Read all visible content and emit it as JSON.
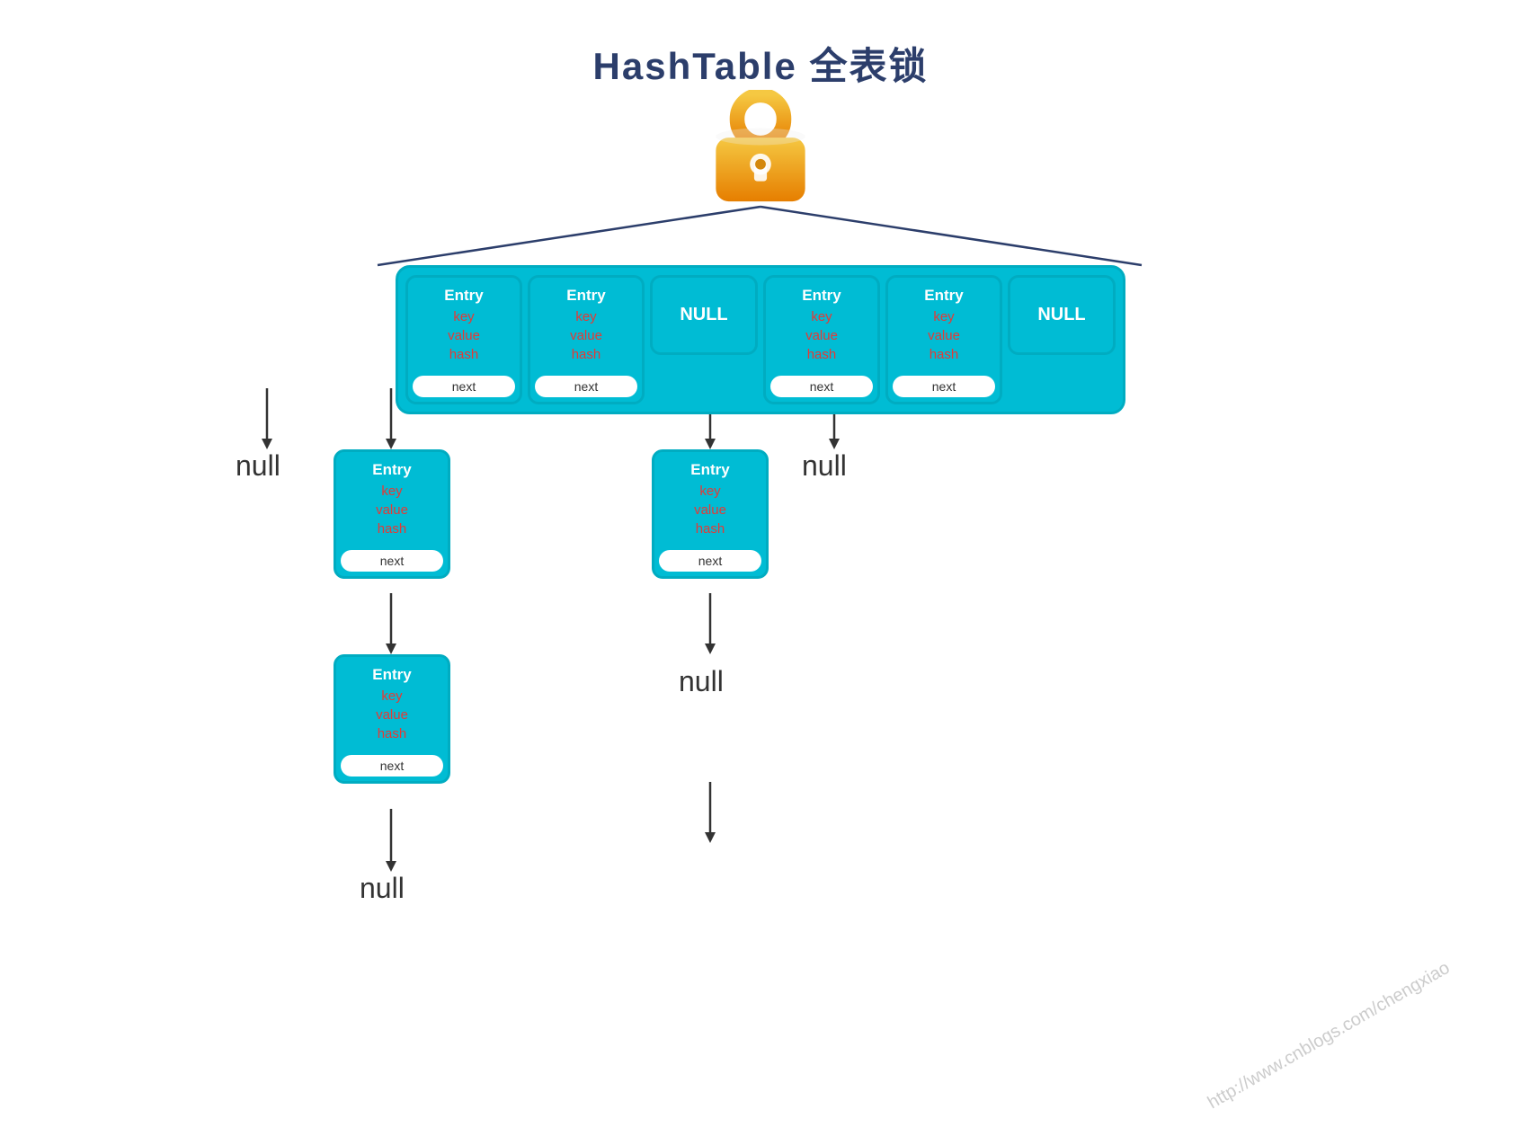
{
  "title": "HashTable 全表锁",
  "lock_icon_label": "lock",
  "watermark": "http://www.cnblogs.com/chengxiao",
  "top_row": {
    "cells": [
      {
        "type": "entry",
        "label": "Entry",
        "fields": [
          "key",
          "value",
          "hash"
        ],
        "next": "next"
      },
      {
        "type": "entry",
        "label": "Entry",
        "fields": [
          "key",
          "value",
          "hash"
        ],
        "next": "next"
      },
      {
        "type": "null_cell",
        "label": "NULL"
      },
      {
        "type": "entry",
        "label": "Entry",
        "fields": [
          "key",
          "value",
          "hash"
        ],
        "next": "next"
      },
      {
        "type": "entry",
        "label": "Entry",
        "fields": [
          "key",
          "value",
          "hash"
        ],
        "next": "next"
      },
      {
        "type": "null_cell",
        "label": "NULL"
      }
    ]
  },
  "null_labels": [
    "null",
    "null",
    "null",
    "null"
  ],
  "chain1": {
    "entries": [
      {
        "label": "Entry",
        "fields": [
          "key",
          "value",
          "hash"
        ],
        "next": "next"
      },
      {
        "label": "Entry",
        "fields": [
          "key",
          "value",
          "hash"
        ],
        "next": "next"
      }
    ],
    "null_label": "null"
  },
  "chain2": {
    "entries": [
      {
        "label": "Entry",
        "fields": [
          "key",
          "value",
          "hash"
        ],
        "next": "next"
      }
    ],
    "null_label": "null"
  }
}
